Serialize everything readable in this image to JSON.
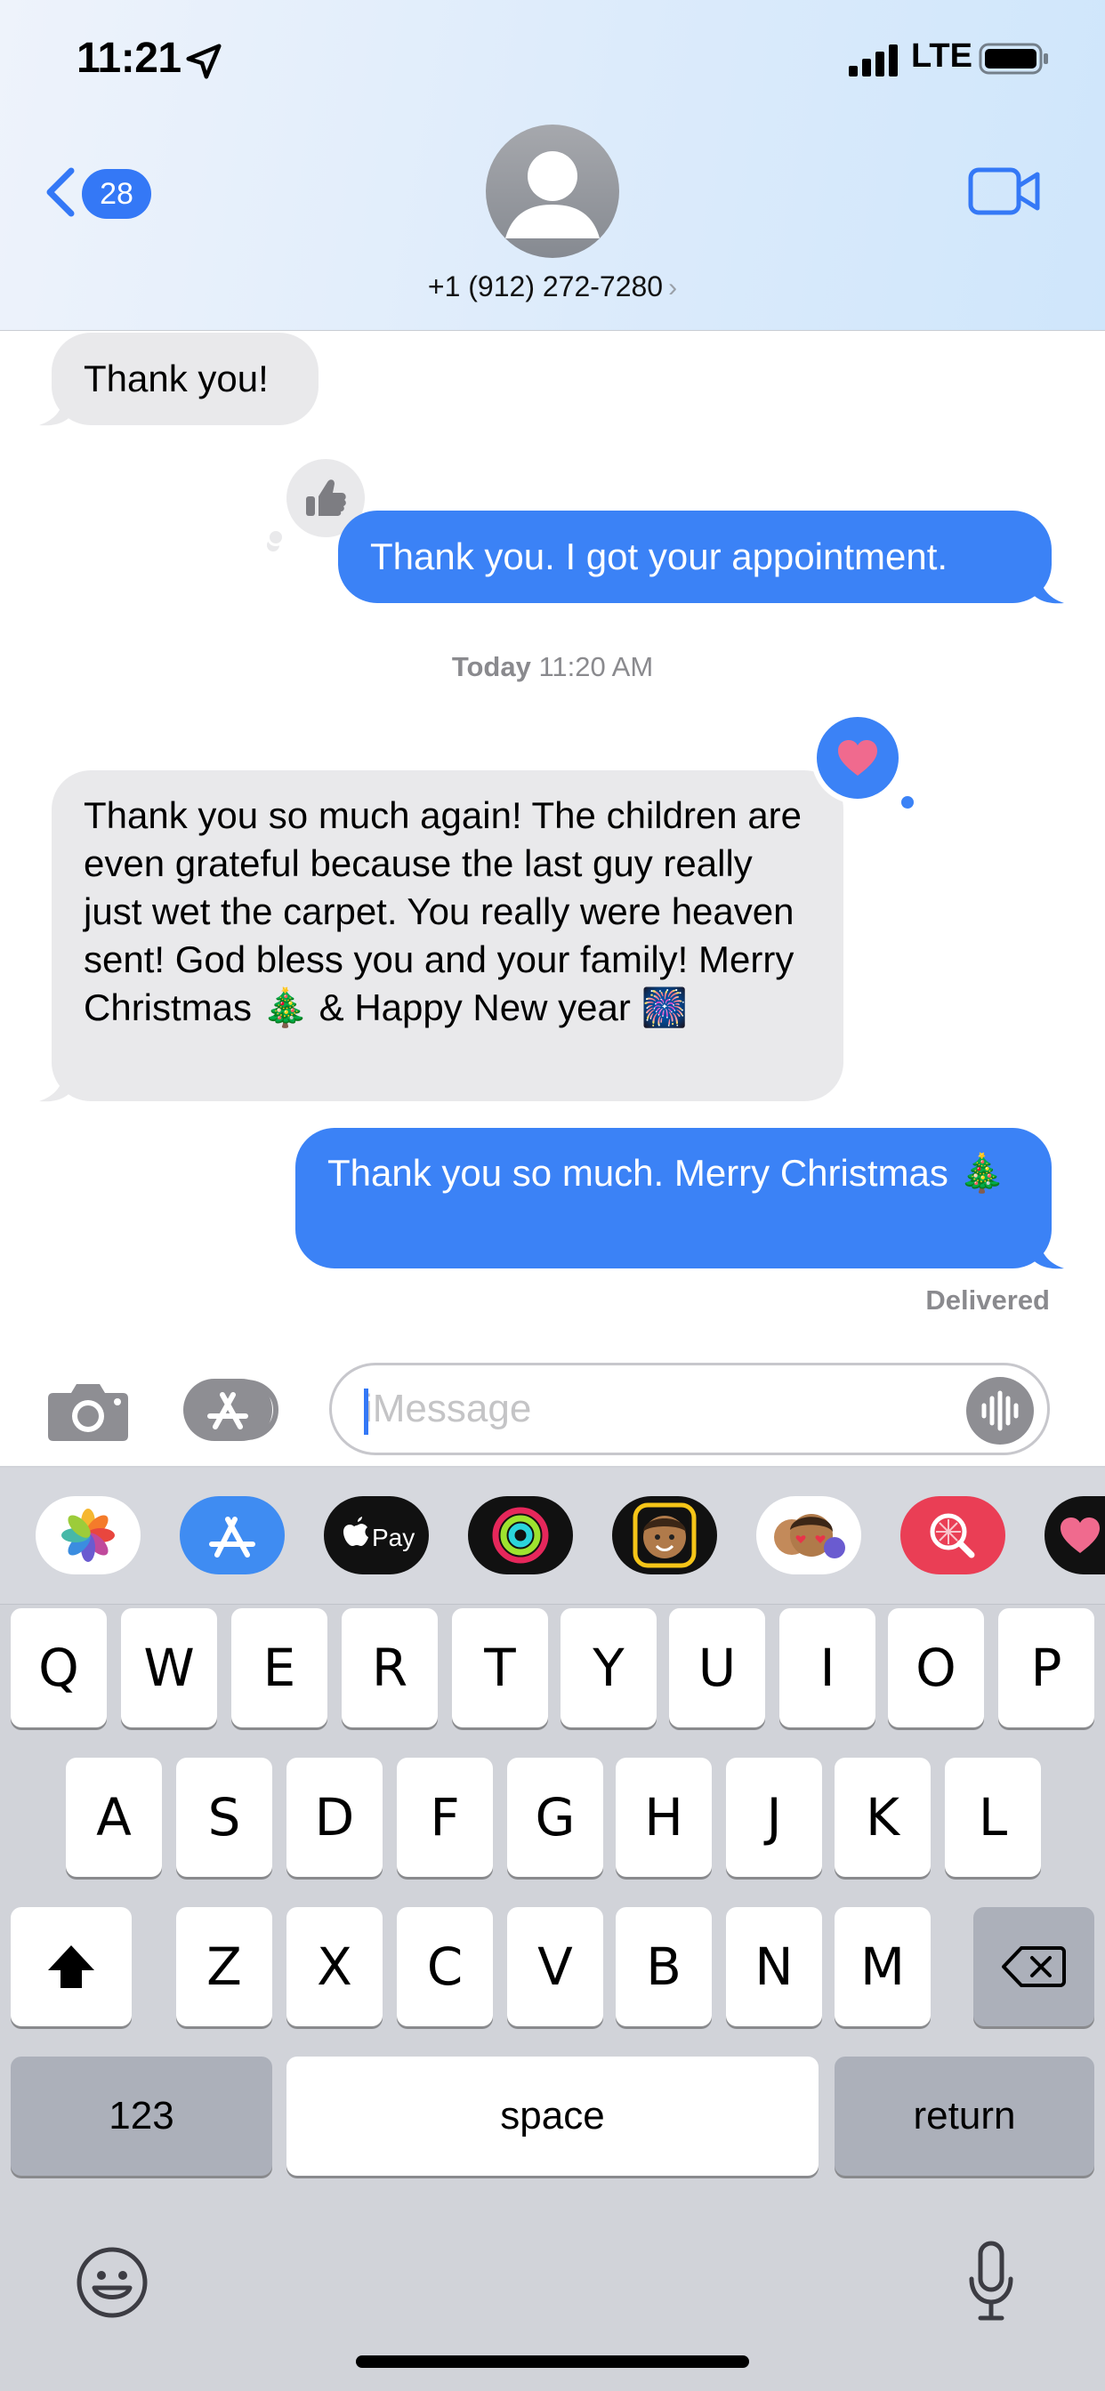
{
  "status_bar": {
    "time": "11:21",
    "network": "LTE"
  },
  "header": {
    "back_badge": "28",
    "contact": "+1 (912) 272-7280",
    "contact_chevron": "›"
  },
  "messages": [
    {
      "direction": "incoming",
      "text": "Thank you!"
    },
    {
      "direction": "outgoing",
      "text": "Thank you. I got your appointment.",
      "tapback": "thumbs-up"
    },
    {
      "direction": "incoming",
      "text": "Thank you so much again! The children are even grateful because the last guy really just wet the carpet. You really were heaven sent! God bless you and your family! Merry Christmas 🎄 & Happy New year 🎆",
      "tapback": "heart"
    },
    {
      "direction": "outgoing",
      "text": "Thank you so much. Merry Christmas 🎄"
    }
  ],
  "timestamp": {
    "day": "Today",
    "time": "11:20 AM"
  },
  "delivered": "Delivered",
  "input": {
    "placeholder": "iMessage"
  },
  "app_drawer": [
    "photos",
    "app-store",
    "apple-pay",
    "fitness",
    "memoji",
    "memoji-stickers",
    "search-images",
    "digital-touch"
  ],
  "keyboard": {
    "row1": [
      "Q",
      "W",
      "E",
      "R",
      "T",
      "Y",
      "U",
      "I",
      "O",
      "P"
    ],
    "row2": [
      "A",
      "S",
      "D",
      "F",
      "G",
      "H",
      "J",
      "K",
      "L"
    ],
    "row3": [
      "Z",
      "X",
      "C",
      "V",
      "B",
      "N",
      "M"
    ],
    "numbers": "123",
    "space": "space",
    "return": "return"
  },
  "colors": {
    "accent": "#3478f6",
    "outgoing_bubble": "#3b82f6",
    "incoming_bubble": "#e9e9eb",
    "heart": "#f06a8e",
    "keyboard_bg": "#d1d3d9"
  }
}
